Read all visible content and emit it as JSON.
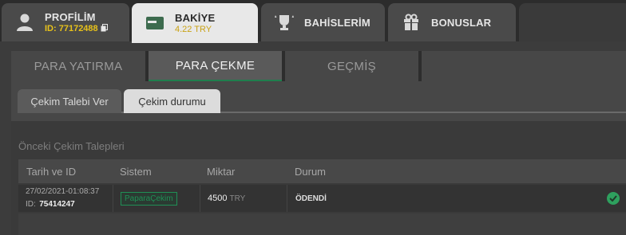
{
  "header": {
    "profile": {
      "title": "PROFİLİM",
      "id_label": "ID: 77172488"
    },
    "balance": {
      "title": "BAKİYE",
      "amount": "4.22 TRY"
    },
    "bets": {
      "title": "BAHİSLERİM"
    },
    "bonuses": {
      "title": "BONUSLAR"
    }
  },
  "tabs": [
    "PARA YATIRMA",
    "PARA ÇEKME",
    "GEÇMİŞ"
  ],
  "inner_tabs": [
    "Çekim Talebi Ver",
    "Çekim durumu"
  ],
  "section": {
    "title": "Önceki Çekim Talepleri",
    "columns": [
      "Tarih ve ID",
      "Sistem",
      "Miktar",
      "Durum"
    ],
    "rows": [
      {
        "date": "27/02/2021-01:08:37",
        "id_label": "ID:",
        "id": "75414247",
        "system": "PaparaÇekim",
        "amount": "4500",
        "currency": "TRY",
        "status": "ÖDENDİ"
      }
    ]
  },
  "colors": {
    "accent_green": "#1f8f55",
    "balance_yellow": "#e8c21a",
    "success": "#2ea05e"
  }
}
